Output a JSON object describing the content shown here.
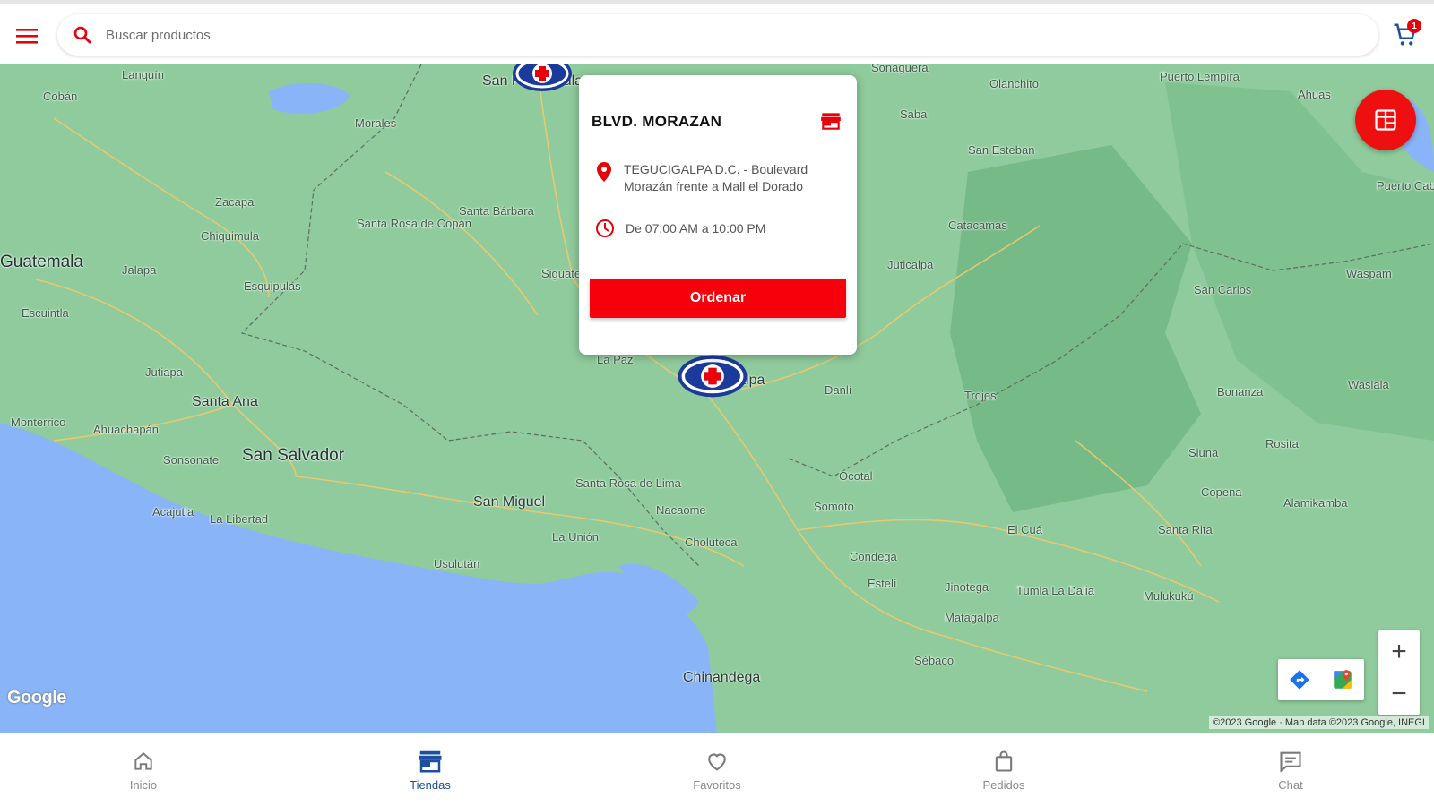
{
  "header": {
    "search_placeholder": "Buscar productos",
    "cart_count": "1"
  },
  "colors": {
    "brand_red": "#f5000b",
    "brand_blue": "#1d4fa0",
    "map_land": "#8bc79a",
    "map_water": "#8ab4f8"
  },
  "map": {
    "places": [
      {
        "name": "Guatemala",
        "size": "big"
      },
      {
        "name": "San Salvador",
        "size": "big"
      },
      {
        "name": "Santa Ana",
        "size": "med"
      },
      {
        "name": "San Miguel",
        "size": "med"
      },
      {
        "name": "Chinandega",
        "size": "med"
      },
      {
        "name": "Cobán",
        "size": "small"
      },
      {
        "name": "Lanquín",
        "size": "small"
      },
      {
        "name": "Morales",
        "size": "small"
      },
      {
        "name": "Zacapa",
        "size": "small"
      },
      {
        "name": "Chiquimula",
        "size": "small"
      },
      {
        "name": "Jalapa",
        "size": "small"
      },
      {
        "name": "Esquipulas",
        "size": "small"
      },
      {
        "name": "Santa Rosa de Copán",
        "size": "small"
      },
      {
        "name": "Santa Bárbara",
        "size": "small"
      },
      {
        "name": "Jutiapa",
        "size": "small"
      },
      {
        "name": "Ahuachapán",
        "size": "small"
      },
      {
        "name": "Sonsonate",
        "size": "small"
      },
      {
        "name": "Acajutla",
        "size": "small"
      },
      {
        "name": "La Libertad",
        "size": "small"
      },
      {
        "name": "Usulután",
        "size": "small"
      },
      {
        "name": "La Unión",
        "size": "small"
      },
      {
        "name": "Santa Rosa de Lima",
        "size": "small"
      },
      {
        "name": "Nacaome",
        "size": "small"
      },
      {
        "name": "Choluteca",
        "size": "small"
      },
      {
        "name": "La Paz",
        "size": "small"
      },
      {
        "name": "Danlí",
        "size": "small"
      },
      {
        "name": "Juticalpa",
        "size": "small"
      },
      {
        "name": "Catacamas",
        "size": "small"
      },
      {
        "name": "Siguatepeque",
        "size": "small"
      },
      {
        "name": "Sonaguera",
        "size": "small"
      },
      {
        "name": "Saba",
        "size": "small"
      },
      {
        "name": "San Esteban",
        "size": "small"
      },
      {
        "name": "Olanchito",
        "size": "small"
      },
      {
        "name": "Ahuas",
        "size": "small"
      },
      {
        "name": "Puerto Lempira",
        "size": "small"
      },
      {
        "name": "Waspam",
        "size": "small"
      },
      {
        "name": "San Carlos",
        "size": "small"
      },
      {
        "name": "Bonanza",
        "size": "small"
      },
      {
        "name": "Siuna",
        "size": "small"
      },
      {
        "name": "Rosita",
        "size": "small"
      },
      {
        "name": "Waslala",
        "size": "small"
      },
      {
        "name": "Jinotega",
        "size": "small"
      },
      {
        "name": "Estelí",
        "size": "small"
      },
      {
        "name": "Condega",
        "size": "small"
      },
      {
        "name": "Matagalpa",
        "size": "small"
      },
      {
        "name": "Sébaco",
        "size": "small"
      },
      {
        "name": "Somoto",
        "size": "small"
      },
      {
        "name": "Ocotal",
        "size": "small"
      },
      {
        "name": "El Cuá",
        "size": "small"
      },
      {
        "name": "Santa Rita",
        "size": "small"
      },
      {
        "name": "Tumla La Dalia",
        "size": "small"
      },
      {
        "name": "Mulukukú",
        "size": "small"
      },
      {
        "name": "Copena",
        "size": "small"
      },
      {
        "name": "Alamikamba",
        "size": "small"
      },
      {
        "name": "Trojes",
        "size": "small"
      },
      {
        "name": "San Pedro Sula",
        "size": "small"
      },
      {
        "name": "Tegucigalpa",
        "size": "med"
      },
      {
        "name": "Escuintla",
        "size": "small"
      },
      {
        "name": "Monterrico",
        "size": "small"
      },
      {
        "name": "Puerto Cabezas",
        "size": "small"
      }
    ],
    "copyright": "©2023 Google · Map data ©2023 Google, INEGI",
    "google_logo": "Google",
    "zoom_in": "+",
    "zoom_out": "−"
  },
  "popup": {
    "store_name": "BLVD. MORAZAN",
    "address": "TEGUCIGALPA D.C. - Boulevard Morazán frente a Mall el Dorado",
    "hours": "De 07:00 AM a 10:00 PM",
    "order_label": "Ordenar"
  },
  "nav": {
    "items": [
      {
        "label": "Inicio",
        "icon": "home-icon",
        "active": false
      },
      {
        "label": "Tiendas",
        "icon": "store-icon",
        "active": true
      },
      {
        "label": "Favoritos",
        "icon": "heart-icon",
        "active": false
      },
      {
        "label": "Pedidos",
        "icon": "shopping-bag-icon",
        "active": false
      },
      {
        "label": "Chat",
        "icon": "chat-icon",
        "active": false
      }
    ]
  }
}
